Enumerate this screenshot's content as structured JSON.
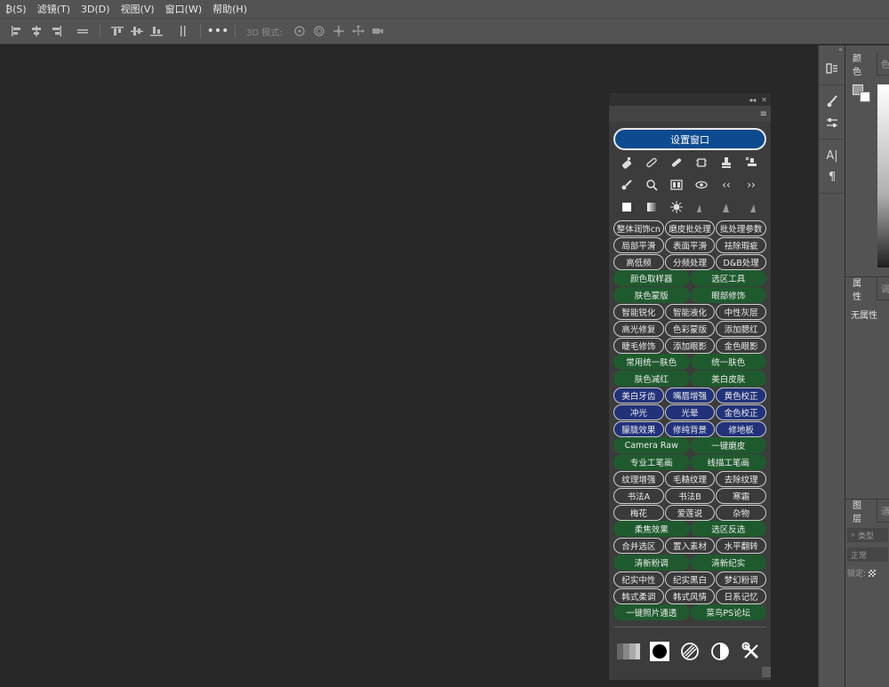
{
  "menubar": {
    "items": [
      "₿(S)",
      "滤镜(T)",
      "3D(D)",
      "视图(V)",
      "窗口(W)",
      "帮助(H)"
    ]
  },
  "optbar": {
    "mode_label": "3D 模式:",
    "icons": [
      "align-left-icon",
      "align-hcenter-icon",
      "align-right-icon",
      "distribute-icon",
      "align-top-icon",
      "align-vcenter-icon",
      "align-bottom-icon",
      "distribute-v-icon",
      "more-icon"
    ]
  },
  "right_panels": {
    "color_tab": "颜色",
    "color_tab2": "色",
    "properties_tab": "属性",
    "properties_tab2": "调",
    "no_properties": "无属性",
    "layers_tab": "图层",
    "layers_tab2": "通",
    "layer_search": "类型",
    "blend_mode": "正常",
    "lock_label": "锁定:"
  },
  "plugin": {
    "settings_label": "设置窗口",
    "rows": [
      [
        {
          "t": "整体润饰cn",
          "c": "dark"
        },
        {
          "t": "磨皮批处理",
          "c": "dark"
        },
        {
          "t": "批处理参数",
          "c": "dark"
        }
      ],
      [
        {
          "t": "局部平滑",
          "c": "dark"
        },
        {
          "t": "表面平滑",
          "c": "dark"
        },
        {
          "t": "祛除瑕疵",
          "c": "dark"
        }
      ],
      [
        {
          "t": "高低频",
          "c": "dark"
        },
        {
          "t": "分频处理",
          "c": "dark"
        },
        {
          "t": "D&B处理",
          "c": "dark"
        }
      ],
      [
        {
          "t": "颜色取样器",
          "c": "green"
        },
        {
          "t": "选区工具",
          "c": "green"
        }
      ],
      [
        {
          "t": "肤色蒙版",
          "c": "green"
        },
        {
          "t": "眼部修饰",
          "c": "green"
        }
      ],
      [
        {
          "t": "智能锐化",
          "c": "dark"
        },
        {
          "t": "智能液化",
          "c": "dark"
        },
        {
          "t": "中性灰层",
          "c": "dark"
        }
      ],
      [
        {
          "t": "高光修复",
          "c": "dark"
        },
        {
          "t": "色彩蒙版",
          "c": "dark"
        },
        {
          "t": "添加腮红",
          "c": "dark"
        }
      ],
      [
        {
          "t": "睫毛修饰",
          "c": "dark"
        },
        {
          "t": "添加眼影",
          "c": "dark"
        },
        {
          "t": "金色眼影",
          "c": "dark"
        }
      ],
      [
        {
          "t": "常用统一肤色",
          "c": "green"
        },
        {
          "t": "统一肤色",
          "c": "green"
        }
      ],
      [
        {
          "t": "肤色减红",
          "c": "green"
        },
        {
          "t": "美白皮肤",
          "c": "green"
        }
      ],
      [
        {
          "t": "美白牙齿",
          "c": "blue"
        },
        {
          "t": "嘴唇增强",
          "c": "blue"
        },
        {
          "t": "黄色校正",
          "c": "blue"
        }
      ],
      [
        {
          "t": "冲光",
          "c": "blue"
        },
        {
          "t": "光晕",
          "c": "blue"
        },
        {
          "t": "金色校正",
          "c": "blue"
        }
      ],
      [
        {
          "t": "朦胧效果",
          "c": "blue"
        },
        {
          "t": "修纯背景",
          "c": "blue"
        },
        {
          "t": "修地板",
          "c": "blue"
        }
      ],
      [
        {
          "t": "Camera Raw",
          "c": "green"
        },
        {
          "t": "一键磨皮",
          "c": "green"
        }
      ],
      [
        {
          "t": "专业工笔画",
          "c": "green"
        },
        {
          "t": "线描工笔画",
          "c": "green"
        }
      ],
      [
        {
          "t": "纹理增强",
          "c": "dark"
        },
        {
          "t": "毛糙纹理",
          "c": "dark"
        },
        {
          "t": "去除纹理",
          "c": "dark"
        }
      ],
      [
        {
          "t": "书法A",
          "c": "dark"
        },
        {
          "t": "书法B",
          "c": "dark"
        },
        {
          "t": "寒霜",
          "c": "dark"
        }
      ],
      [
        {
          "t": "梅花",
          "c": "dark"
        },
        {
          "t": "爱莲说",
          "c": "dark"
        },
        {
          "t": "杂物",
          "c": "dark"
        }
      ],
      [
        {
          "t": "柔焦效果",
          "c": "green"
        },
        {
          "t": "选区反选",
          "c": "green"
        }
      ],
      [
        {
          "t": "合并选区",
          "c": "dark"
        },
        {
          "t": "置入素材",
          "c": "dark"
        },
        {
          "t": "水平翻转",
          "c": "dark"
        }
      ],
      [
        {
          "t": "清新粉调",
          "c": "green"
        },
        {
          "t": "清新纪实",
          "c": "green"
        }
      ],
      [
        {
          "t": "纪实中性",
          "c": "dark"
        },
        {
          "t": "纪实黑白",
          "c": "dark"
        },
        {
          "t": "梦幻粉调",
          "c": "dark"
        }
      ],
      [
        {
          "t": "韩式柔调",
          "c": "dark"
        },
        {
          "t": "韩式风情",
          "c": "dark"
        },
        {
          "t": "日系记忆",
          "c": "dark"
        }
      ],
      [
        {
          "t": "一键照片通透",
          "c": "green"
        },
        {
          "t": "菜鸟PS论坛",
          "c": "green"
        }
      ]
    ]
  }
}
